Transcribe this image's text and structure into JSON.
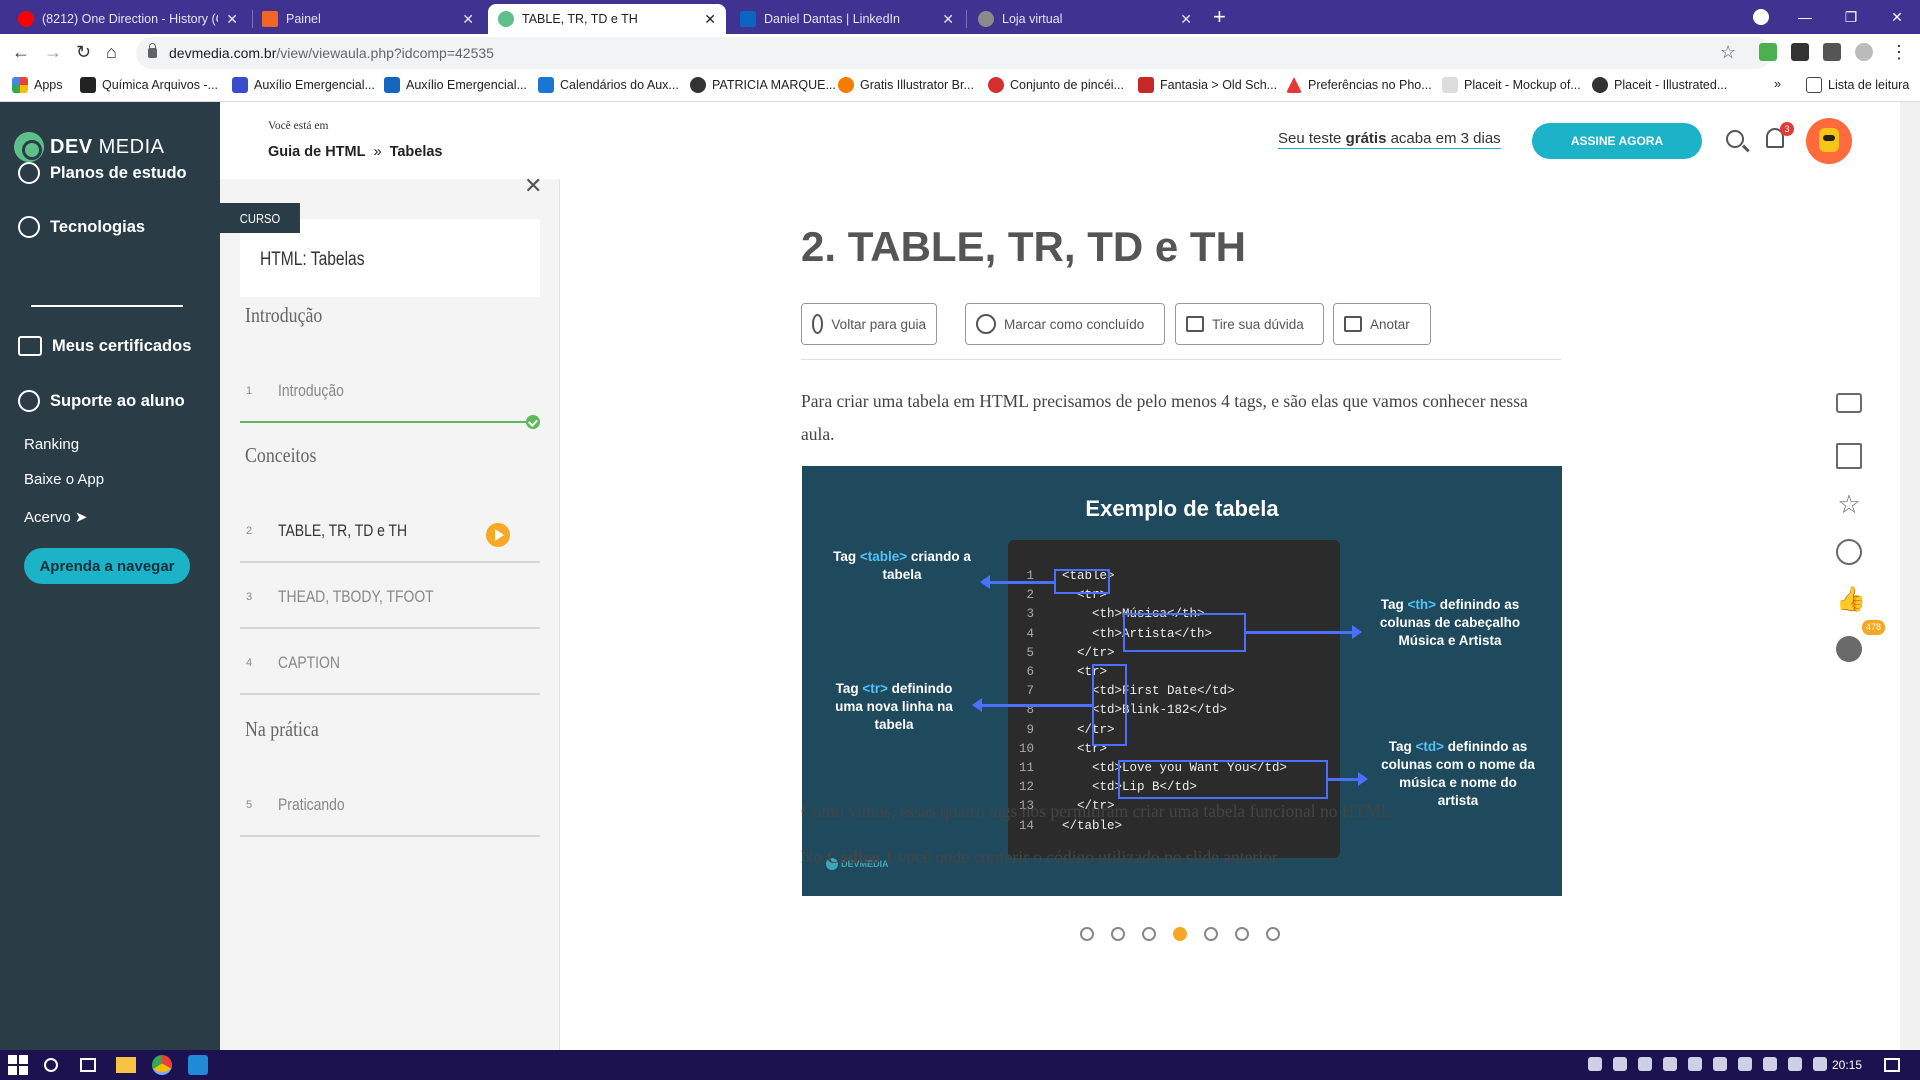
{
  "browser": {
    "tabs": [
      {
        "title": "(8212) One Direction - History (C",
        "color": "#ff0000"
      },
      {
        "title": "Painel",
        "color": "#f26522"
      },
      {
        "title": "TABLE, TR, TD e TH",
        "color": "#5fbf8b"
      },
      {
        "title": "Daniel Dantas | LinkedIn",
        "color": "#0a66c2"
      },
      {
        "title": "Loja virtual",
        "color": "#8a8a8a"
      }
    ],
    "new_tab": "+",
    "url_host": "devmedia.com.br",
    "url_path": "/view/viewaula.php?idcomp=42535",
    "bookmarks": [
      "Apps",
      "Química Arquivos -...",
      "Auxílio Emergencial...",
      "Auxílio Emergencial...",
      "Calendários do Aux...",
      "PATRICIA MARQUE...",
      "Gratis Illustrator Br...",
      "Conjunto de pincéi...",
      "Fantasia > Old Sch...",
      "Preferências no Pho...",
      "Placeit - Mockup of...",
      "Placeit - Illustrated..."
    ],
    "bookmarks_more": "»",
    "reading_list": "Lista de leitura"
  },
  "sidebar": {
    "logo_bold": "DEV",
    "logo_thin": "MEDIA",
    "nav": [
      "Planos de estudo",
      "Tecnologias",
      "Meus certificados",
      "Suporte ao aluno"
    ],
    "links": [
      "Ranking",
      "Baixe o App",
      "Acervo ➤"
    ],
    "cta": "Aprenda a navegar"
  },
  "header": {
    "you_are_in": "Você está em",
    "crumb_guide": "Guia de HTML",
    "crumb_sep": "»",
    "crumb_current": "Tabelas",
    "trial_pre": "Seu teste",
    "trial_bold": "grátis",
    "trial_post": "acaba em 3 dias",
    "subscribe": "ASSINE AGORA",
    "notifications": "3"
  },
  "course": {
    "tag": "CURSO",
    "title": "HTML: Tabelas",
    "close": "✕",
    "sections": [
      {
        "name": "Introdução",
        "lessons": [
          {
            "num": "1",
            "title": "Introdução",
            "state": "done"
          }
        ]
      },
      {
        "name": "Conceitos",
        "lessons": [
          {
            "num": "2",
            "title": "TABLE, TR, TD e TH",
            "state": "current"
          },
          {
            "num": "3",
            "title": "THEAD, TBODY, TFOOT",
            "state": "todo"
          },
          {
            "num": "4",
            "title": "CAPTION",
            "state": "todo"
          }
        ]
      },
      {
        "name": "Na prática",
        "lessons": [
          {
            "num": "5",
            "title": "Praticando",
            "state": "todo"
          }
        ]
      }
    ]
  },
  "lesson": {
    "title": "2. TABLE, TR, TD e TH",
    "actions": [
      "Voltar para guia",
      "Marcar como concluído",
      "Tire sua dúvida",
      "Anotar"
    ],
    "intro": "Para criar uma tabela em HTML precisamos de pelo menos 4 tags, e são elas que vamos conhecer nessa aula.",
    "after": "Como vimos, essas quatro tags nos permitiram criar uma tabela funcional no HTML.",
    "partial_pre": "No",
    "partial_bold": "Código 1",
    "partial_post": "você pode conferir o código utilizado no slide anterior"
  },
  "slide": {
    "title": "Exemplo de tabela",
    "code_lines": [
      {
        "n": "1",
        "t": "<table>"
      },
      {
        "n": "2",
        "t": "  <tr>"
      },
      {
        "n": "3",
        "t": "    <th>Música</th>"
      },
      {
        "n": "4",
        "t": "    <th>Artista</th>"
      },
      {
        "n": "5",
        "t": "  </tr>"
      },
      {
        "n": "6",
        "t": "  <tr>"
      },
      {
        "n": "7",
        "t": "    <td>First Date</td>"
      },
      {
        "n": "8",
        "t": "    <td>Blink-182</td>"
      },
      {
        "n": "9",
        "t": "  </tr>"
      },
      {
        "n": "10",
        "t": "  <tr>"
      },
      {
        "n": "11",
        "t": "    <td>Love you Want You</td>"
      },
      {
        "n": "12",
        "t": "    <td>Lip B</td>"
      },
      {
        "n": "13",
        "t": "  </tr>"
      },
      {
        "n": "14",
        "t": "</table>"
      }
    ],
    "annotations": {
      "table": {
        "pre": "Tag ",
        "tag": "<table>",
        "post": " criando a tabela"
      },
      "th": {
        "pre": "Tag ",
        "tag": "<th>",
        "post": " definindo as colunas de cabeçalho Música e Artista"
      },
      "tr": {
        "pre": "Tag ",
        "tag": "<tr>",
        "post": " definindo uma nova linha na tabela"
      },
      "td": {
        "pre": "Tag ",
        "tag": "<td>",
        "post": " definindo as colunas com o nome da música e nome do artista"
      }
    },
    "watermark": "DEVMEDIA",
    "page_count": 7,
    "active_page": 4
  },
  "tools": {
    "likes": "478"
  },
  "taskbar": {
    "time": "20:15"
  },
  "colors": {
    "accent": "#1cb3c8",
    "sidebar": "#2a3d47",
    "tabbar": "#3f3291",
    "slide_bg": "#1f4a5e",
    "highlight": "#4b6fff",
    "orange": "#f6a623"
  }
}
